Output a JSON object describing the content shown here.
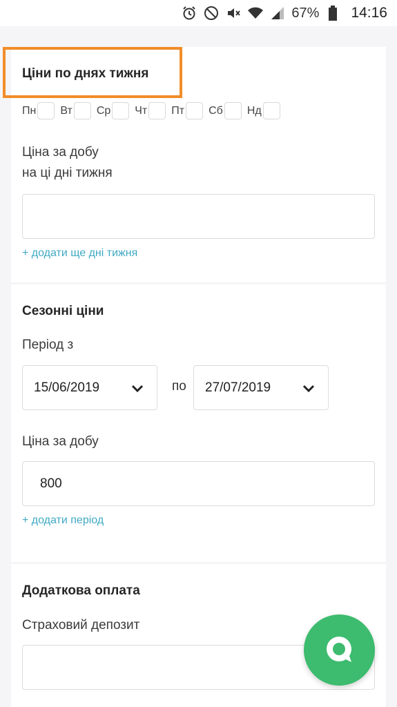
{
  "status_bar": {
    "battery": "67%",
    "time": "14:16"
  },
  "weekday_prices": {
    "title": "Ціни по днях тижня",
    "days": [
      "Пн",
      "Вт",
      "Ср",
      "Чт",
      "Пт",
      "Сб",
      "Нд"
    ],
    "price_label_line1": "Ціна за добу",
    "price_label_line2": "на ці дні тижня",
    "price_value": "",
    "add_link": "+ додати ще дні тижня"
  },
  "seasonal_prices": {
    "title": "Сезонні ціни",
    "period_label": "Період з",
    "from_date": "15/06/2019",
    "to_label": "по",
    "to_date": "27/07/2019",
    "price_label": "Ціна за добу",
    "price_value": "800",
    "add_link": "+ додати період"
  },
  "extra_payment": {
    "title": "Додаткова оплата",
    "deposit_label": "Страховий депозит",
    "deposit_value": ""
  },
  "colors": {
    "accent_link": "#3fa9c4",
    "highlight": "#f28c28",
    "fab": "#3dbb6e"
  }
}
